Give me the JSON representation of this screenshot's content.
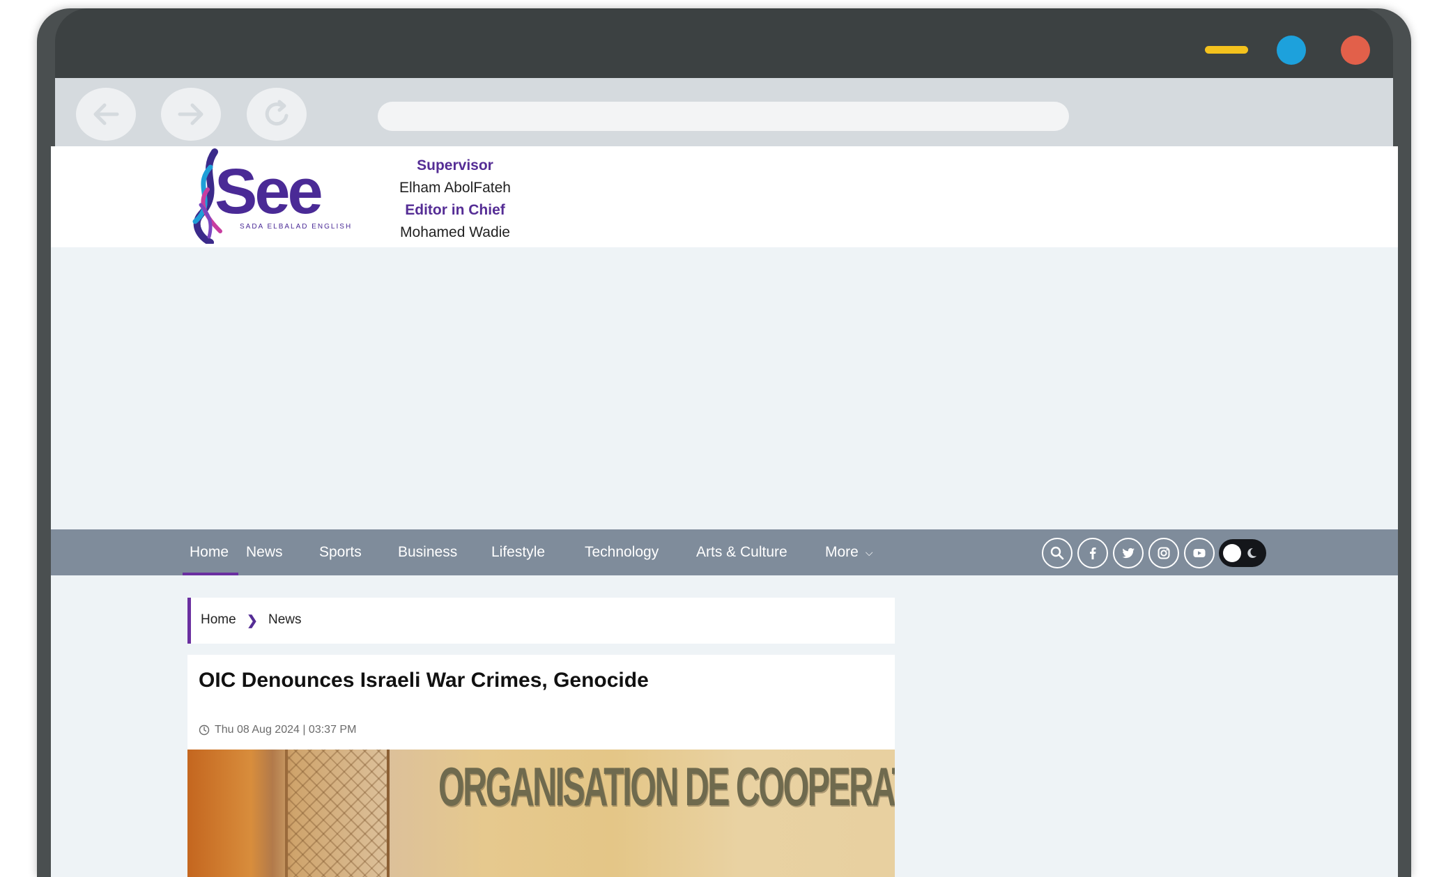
{
  "browser": {
    "window_controls": {
      "minimize_color": "#f4c21d",
      "maximize_color": "#1da1dc",
      "close_color": "#e2604a"
    },
    "nav_icons": [
      "back-arrow-icon",
      "forward-arrow-icon",
      "reload-icon"
    ],
    "address_bar": ""
  },
  "site": {
    "logo_text": "See",
    "logo_tagline": "SADA ELBALAD ENGLISH",
    "staff": {
      "supervisor_label": "Supervisor",
      "supervisor_name": "Elham AbolFateh",
      "editor_label": "Editor in Chief",
      "editor_name": "Mohamed Wadie"
    },
    "brand_color": "#552d95"
  },
  "nav": {
    "items": [
      {
        "label": "Home",
        "active": true
      },
      {
        "label": "News"
      },
      {
        "label": "Sports"
      },
      {
        "label": "Business"
      },
      {
        "label": "Lifestyle"
      },
      {
        "label": "Technology"
      },
      {
        "label": "Arts & Culture"
      },
      {
        "label": "More"
      }
    ],
    "more_icon": "chevron-down-icon",
    "social_icons": [
      "search-icon",
      "facebook-icon",
      "twitter-icon",
      "instagram-icon",
      "youtube-icon"
    ],
    "theme_toggle": "dark-mode-toggle"
  },
  "breadcrumb": {
    "home": "Home",
    "current": "News"
  },
  "article": {
    "title": "OIC Denounces Israeli War Crimes, Genocide",
    "date": "Thu 08 Aug 2024 | 03:37 PM",
    "image_text": "ORGANISATION DE COOPERATION ISLAMIQ"
  }
}
